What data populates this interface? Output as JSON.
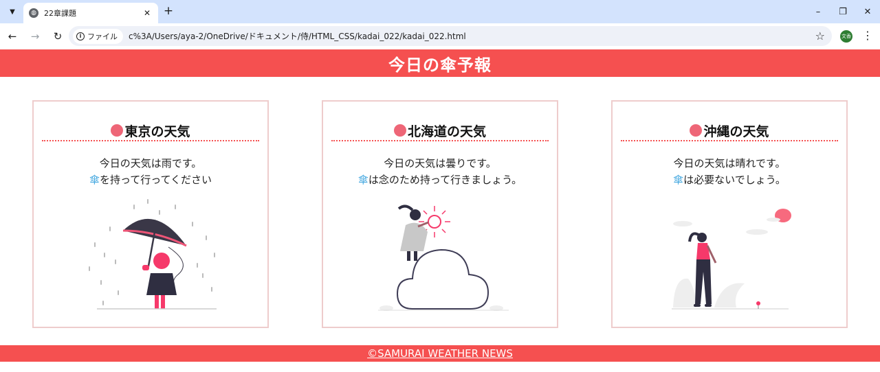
{
  "browser": {
    "tab_title": "22章課題",
    "url_chip": "ファイル",
    "url": "c%3A/Users/aya-2/OneDrive/ドキュメント/侍/HTML_CSS/kadai_022/kadai_022.html",
    "profile_label": "文香"
  },
  "page": {
    "header_title": "今日の傘予報",
    "footer_text": "©SAMURAI WEATHER NEWS"
  },
  "cards": [
    {
      "title": "東京の天気",
      "line1": "今日の天気は雨です。",
      "umbrella": "傘",
      "line2": "を持って行ってください",
      "illustration": "rain-umbrella-illustration"
    },
    {
      "title": "北海道の天気",
      "line1": "今日の天気は曇りです。",
      "umbrella": "傘",
      "line2": "は念のため持って行きましょう。",
      "illustration": "cloud-sun-illustration"
    },
    {
      "title": "沖縄の天気",
      "line1": "今日の天気は晴れです。",
      "umbrella": "傘",
      "line2": "は必要ないでしょう。",
      "illustration": "sunny-walk-illustration"
    }
  ],
  "colors": {
    "accent": "#f55050",
    "title_dot": "#ee6677",
    "umbrella_text": "#44a8e0",
    "card_border": "#eecccc"
  }
}
